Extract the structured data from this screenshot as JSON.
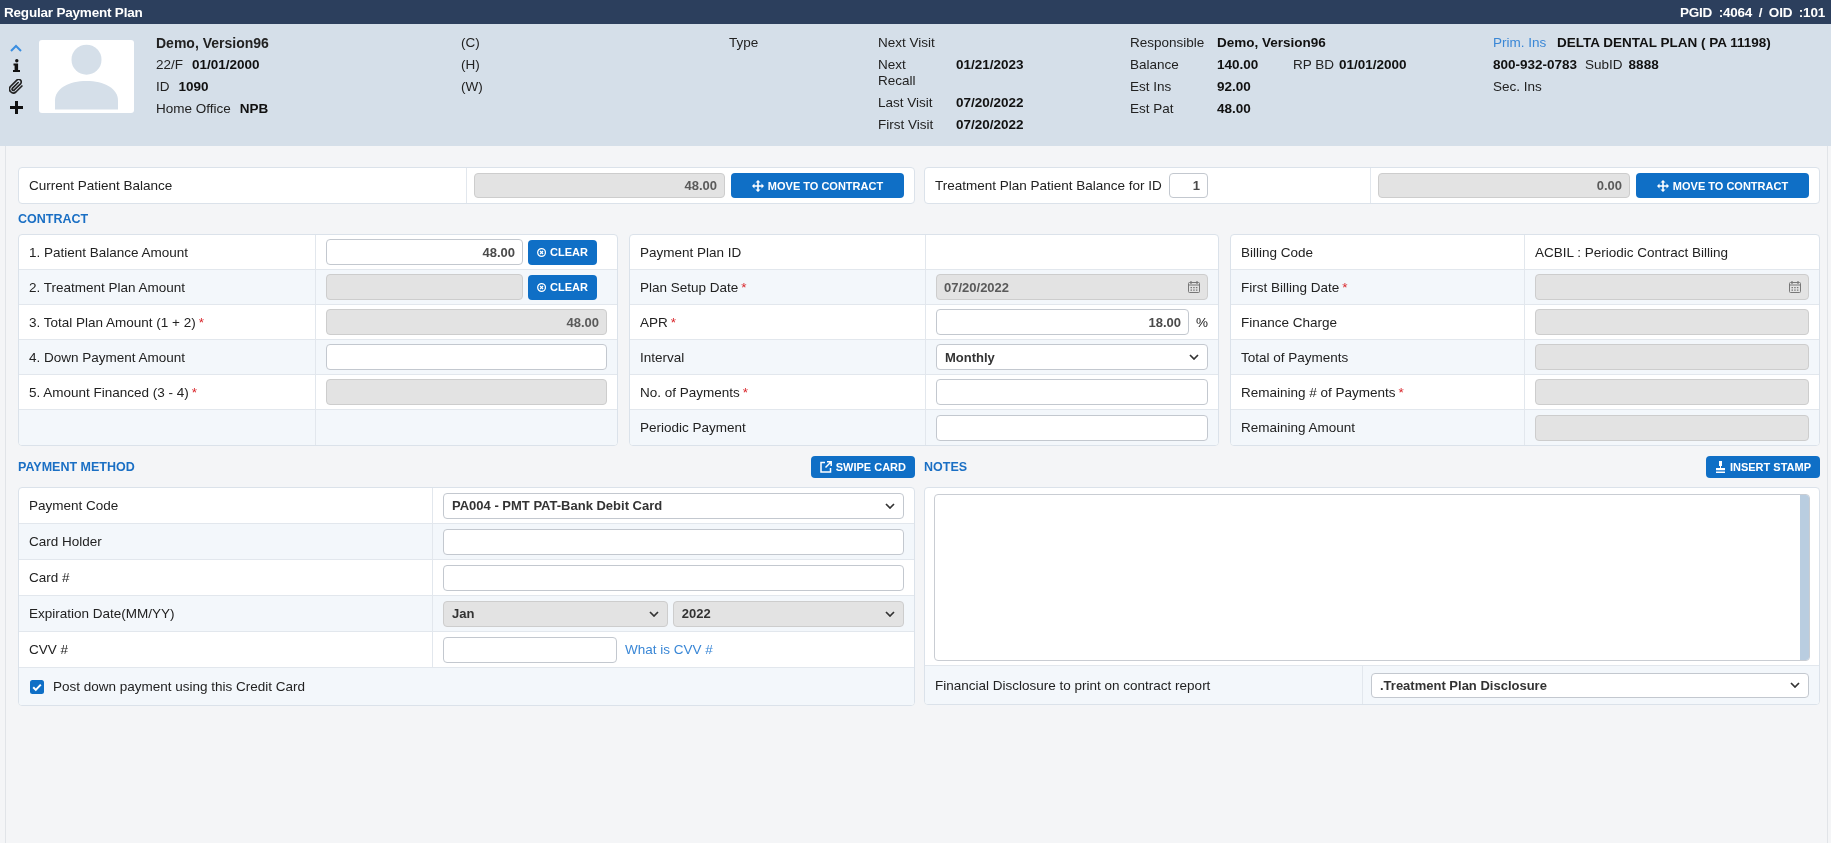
{
  "window": {
    "title": "Regular Payment Plan",
    "record_ids": "PGID :4064 / OID :101"
  },
  "header": {
    "patient": {
      "name": "Demo, Version96",
      "fields": [
        {
          "label": "22/F",
          "value": "01/01/2000"
        },
        {
          "label": "ID",
          "value": "1090"
        },
        {
          "label": "Home Office",
          "value": "NPB"
        }
      ]
    },
    "phones": [
      "(C)",
      "(H)",
      "(W)"
    ],
    "type": {
      "label": "Type"
    },
    "visits": [
      {
        "label": "Next Visit"
      },
      {
        "label": "Next Recall",
        "value": "01/21/2023"
      },
      {
        "label": "Last Visit",
        "value": "07/20/2022"
      },
      {
        "label": "First Visit",
        "value": "07/20/2022"
      }
    ],
    "account": [
      [
        {
          "label": "Responsible",
          "value": "Demo, Version96"
        }
      ],
      [
        {
          "label": "Balance",
          "value": "140.00"
        },
        {
          "label": "RP BD",
          "value": "01/01/2000"
        }
      ],
      [
        {
          "label": "Est Ins",
          "value": "92.00"
        }
      ],
      [
        {
          "label": "Est Pat",
          "value": "48.00"
        }
      ]
    ],
    "insurance": {
      "primary_label": "Prim. Ins",
      "primary_plan": "DELTA DENTAL PLAN ( PA 11198)",
      "phone": "800-932-0783",
      "subid_label": "SubID",
      "subid": "8888",
      "secondary_label": "Sec. Ins"
    }
  },
  "balances": [
    {
      "label": "Current Patient Balance",
      "value": "48.00",
      "disabled": true,
      "button": "MOVE TO CONTRACT"
    },
    {
      "label": "Treatment Plan Patient Balance for ID",
      "id_value": "1",
      "value": "0.00",
      "disabled": true,
      "button": "MOVE TO CONTRACT"
    }
  ],
  "contract": {
    "heading": "CONTRACT",
    "panels": [
      {
        "rows": [
          {
            "label": "1. Patient Balance Amount",
            "kind": "amount",
            "value": "48.00",
            "disabled": false,
            "button": "CLEAR"
          },
          {
            "label": "2. Treatment Plan Amount",
            "kind": "amount",
            "disabled": true,
            "button": "CLEAR"
          },
          {
            "label": "3. Total Plan Amount (1 + 2)",
            "required_mark": "*",
            "kind": "amount",
            "value": "48.00",
            "disabled": true
          },
          {
            "label": "4. Down Payment Amount",
            "kind": "amount",
            "disabled": false
          },
          {
            "label": "5. Amount Financed (3 - 4)",
            "required_mark": "*",
            "kind": "amount",
            "disabled": true
          },
          {
            "kind": "empty"
          }
        ]
      },
      {
        "rows": [
          {
            "label": "Payment Plan ID",
            "kind": "text"
          },
          {
            "label": "Plan Setup Date",
            "required_mark": "*",
            "kind": "date",
            "value": "07/20/2022",
            "disabled": true
          },
          {
            "label": "APR",
            "required_mark": "*",
            "kind": "amount",
            "value": "18.00",
            "unit": "%",
            "disabled": false
          },
          {
            "label": "Interval",
            "kind": "select",
            "value": "Monthly",
            "disabled": false
          },
          {
            "label": "No. of Payments",
            "required_mark": "*",
            "kind": "amount",
            "disabled": false
          },
          {
            "label": "Periodic Payment",
            "kind": "amount",
            "disabled": false
          }
        ]
      },
      {
        "rows": [
          {
            "label": "Billing Code",
            "kind": "text",
            "value": "ACBIL : Periodic Contract Billing"
          },
          {
            "label": "First Billing Date",
            "required_mark": "*",
            "kind": "date",
            "disabled": true
          },
          {
            "label": "Finance Charge",
            "kind": "amount",
            "disabled": true
          },
          {
            "label": "Total of Payments",
            "kind": "amount",
            "disabled": true
          },
          {
            "label": "Remaining # of Payments",
            "required_mark": "*",
            "kind": "amount",
            "disabled": true
          },
          {
            "label": "Remaining Amount",
            "kind": "amount",
            "disabled": true
          }
        ]
      }
    ]
  },
  "payment_method": {
    "heading": "PAYMENT METHOD",
    "button": "SWIPE CARD",
    "rows": [
      {
        "label": "Payment Code",
        "kind": "select",
        "value": "PA004 - PMT PAT-Bank Debit Card",
        "disabled": false
      },
      {
        "label": "Card Holder",
        "kind": "text_input",
        "disabled": false
      },
      {
        "label": "Card #",
        "kind": "text_input",
        "disabled": false
      },
      {
        "label": "Expiration Date(MM/YY)",
        "kind": "select_pair",
        "values": [
          "Jan",
          "2022"
        ],
        "disabled": true
      },
      {
        "label": "CVV #",
        "kind": "short_input",
        "disabled": false,
        "link": "What is CVV #"
      }
    ],
    "checkbox": {
      "label": "Post down payment using this Credit Card",
      "checked": true
    }
  },
  "notes": {
    "heading": "NOTES",
    "button": "INSERT STAMP",
    "disclosure": {
      "label": "Financial Disclosure to print on contract report",
      "value": ".Treatment Plan Disclosure",
      "disabled": false
    }
  }
}
